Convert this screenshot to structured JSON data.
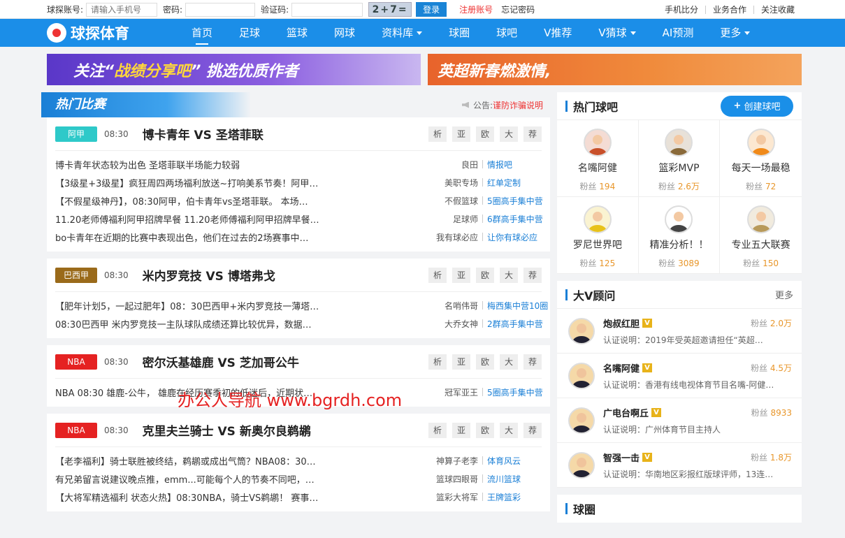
{
  "topbar": {
    "account_label": "球探账号:",
    "account_placeholder": "请输入手机号",
    "password_label": "密码:",
    "captcha_label": "验证码:",
    "captcha_text": "2+7=",
    "login": "登录",
    "register": "注册账号",
    "forgot": "忘记密码",
    "links": [
      "手机比分",
      "业务合作",
      "关注收藏"
    ]
  },
  "nav": {
    "logo": "球探体育",
    "items": [
      {
        "label": "首页",
        "active": true,
        "dropdown": false
      },
      {
        "label": "足球",
        "dropdown": false
      },
      {
        "label": "篮球",
        "dropdown": false
      },
      {
        "label": "网球",
        "dropdown": false
      },
      {
        "label": "资料库",
        "dropdown": true
      },
      {
        "label": "球圈",
        "dropdown": false
      },
      {
        "label": "球吧",
        "dropdown": false
      },
      {
        "label": "V推荐",
        "dropdown": false
      },
      {
        "label": "V猜球",
        "dropdown": true
      },
      {
        "label": "AI预测",
        "dropdown": false
      },
      {
        "label": "更多",
        "dropdown": true
      }
    ]
  },
  "banners": {
    "left_a": "关注“",
    "left_b": "战绩分享吧",
    "left_c": "” 挑选优质作者",
    "right": "英超新春燃激情,"
  },
  "hot": {
    "title": "热门比赛",
    "notice_label": "公告:",
    "notice_text": "谨防诈骗说明",
    "buttons": [
      "析",
      "亚",
      "欧",
      "大",
      "荐"
    ],
    "matches": [
      {
        "league": "阿甲",
        "color": "#2ec9c9",
        "time": "08:30",
        "teams": "博卡青年 VS 圣塔菲联",
        "rows": [
          {
            "text": "博卡青年状态较为出色 圣塔菲联半场能力较弱",
            "author": "良田",
            "group": "情报吧"
          },
          {
            "text": "【3级星+3级星】疯狂周四两场福利放送~打响美系节奏！阿甲…",
            "author": "美职专场",
            "group": "红单定制"
          },
          {
            "text": "【不假星级神丹】，08:30阿甲，伯卡青年vs圣塔菲联。 本场…",
            "author": "不假篮球",
            "group": "5圈高手集中营"
          },
          {
            "text": "11.20老师傅福利阿甲招牌早餐 11.20老师傅福利阿甲招牌早餐…",
            "author": "足球师",
            "group": "6群高手集中营"
          },
          {
            "text": "bo卡青年在近期的比赛中表现出色，他们在过去的2场赛事中…",
            "author": "我有球必应",
            "group": "让你有球必应"
          }
        ]
      },
      {
        "league": "巴西甲",
        "color": "#9a6a1a",
        "time": "08:30",
        "teams": "米内罗竞技 VS 博塔弗戈",
        "rows": [
          {
            "text": "【肥年计划5，一起过肥年】08：30巴西甲+米内罗竞技一薄塔…",
            "author": "名哨伟哥",
            "group": "梅西集中营10圈"
          },
          {
            "text": "08:30巴西甲 米内罗竞技一主队球队成绩还算比较优异，数据…",
            "author": "大乔女神",
            "group": "2群高手集中营"
          }
        ]
      },
      {
        "league": "NBA",
        "color": "#e52222",
        "time": "08:30",
        "teams": "密尔沃基雄鹿 VS 芝加哥公牛",
        "rows": [
          {
            "text": "NBA 08:30 雄鹿-公牛， 雄鹿在经历赛季初的低迷后，近期状…",
            "author": "冠军亚王",
            "group": "5圈高手集中营"
          }
        ]
      },
      {
        "league": "NBA",
        "color": "#e52222",
        "time": "08:30",
        "teams": "克里夫兰骑士 VS 新奥尔良鹈鹕",
        "rows": [
          {
            "text": "【老李福利】骑士联胜被终结，鹈鹕或成出气筒？NBA08：30…",
            "author": "神算子老李",
            "group": "体育风云"
          },
          {
            "text": "有兄弟留言说建议晚点推，emm...可能每个人的节奏不同吧，…",
            "author": "篮球四眼哥",
            "group": "流川篮球"
          },
          {
            "text": "【大将军精选福利 状态火热】08:30NBA，骑士VS鹈鹕！ 赛事…",
            "author": "篮彩大将军",
            "group": "王牌篮彩"
          }
        ]
      }
    ]
  },
  "watermark": "办公人导航 www.bgrdh.com",
  "hot_bars": {
    "title": "热门球吧",
    "create": "创建球吧",
    "fans_label": "粉丝",
    "items": [
      {
        "name": "名嘴阿健",
        "fans": "194",
        "color": "#c8502a"
      },
      {
        "name": "篮彩MVP",
        "fans": "2.6万",
        "color": "#8a6a3a"
      },
      {
        "name": "每天一场最稳",
        "fans": "72",
        "color": "#f08a1a"
      },
      {
        "name": "罗尼世界吧",
        "fans": "125",
        "color": "#e8c21a"
      },
      {
        "name": "精准分析！！",
        "fans": "3089",
        "color": "#444"
      },
      {
        "name": "专业五大联赛",
        "fans": "150",
        "color": "#b89a5a"
      }
    ]
  },
  "bigv": {
    "title": "大V顾问",
    "more": "更多",
    "fans_label": "粉丝",
    "badge": "V",
    "items": [
      {
        "name": "炮叔红胆",
        "fans": "2.0万",
        "desc": "认证说明：2019年受英超邀请担任“英超…"
      },
      {
        "name": "名嘴阿健",
        "fans": "4.5万",
        "desc": "认证说明：香港有线电视体育节目名嘴-阿健…"
      },
      {
        "name": "广电台啊丘",
        "fans": "8933",
        "desc": "认证说明：广州体育节目主持人"
      },
      {
        "name": "智强一击",
        "fans": "1.8万",
        "desc": "认证说明：华南地区彩报红版球评师，13连…"
      }
    ]
  },
  "circle": {
    "title": "球圈"
  }
}
